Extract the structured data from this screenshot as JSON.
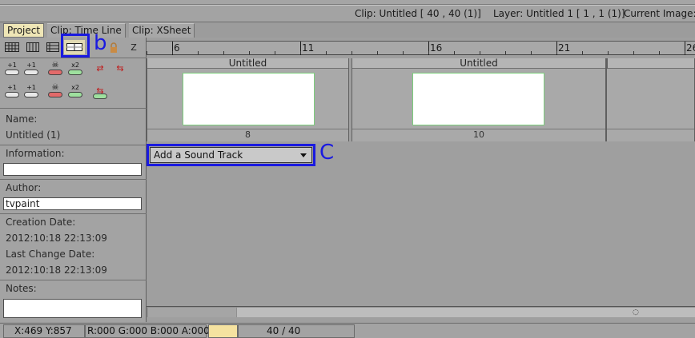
{
  "info_bar": {
    "clip": "Clip: Untitled [ 40 , 40  (1)]",
    "layer": "Layer: Untitled 1 [ 1 , 1  (1)]",
    "current_image": "Current Image:"
  },
  "tabs": [
    {
      "label": "Project",
      "active": true
    },
    {
      "label": "Clip: Time Line",
      "active": false
    },
    {
      "label": "Clip: XSheet",
      "active": false
    }
  ],
  "toolbar": {
    "z_label": "Z",
    "highlight_letter": "b"
  },
  "layer_buttons_row1": [
    "+1",
    "+1",
    "",
    "x2"
  ],
  "layer_buttons_row2": [
    "+1",
    "+1",
    "",
    "x2"
  ],
  "project_panel": {
    "name_label": "Name:",
    "name_value": "Untitled (1)",
    "information_label": "Information:",
    "information_value": "",
    "author_label": "Author:",
    "author_value": "tvpaint",
    "creation_label": "Creation Date:",
    "creation_value": "2012:10:18 22:13:09",
    "last_change_label": "Last Change Date:",
    "last_change_value": "2012:10:18 22:13:09",
    "notes_label": "Notes:",
    "notes_value": ""
  },
  "ruler": {
    "labels": [
      "6",
      "11",
      "16",
      "21",
      "26"
    ]
  },
  "clips": [
    {
      "title": "Untitled",
      "frames": "8"
    },
    {
      "title": "Untitled",
      "frames": "10"
    }
  ],
  "sound_track": {
    "label": "Add a Sound Track",
    "highlight_letter": "C"
  },
  "status_bar": {
    "coords": "X:469  Y:857",
    "rgba": "R:000 G:000 B:000 A:000",
    "frame": "40 / 40"
  },
  "colors": {
    "highlight": "#1a1ae0",
    "active_tab": "#efe6b6",
    "thumb_border": "#7ccf7c",
    "status_swatch": "#f5e2a0"
  }
}
